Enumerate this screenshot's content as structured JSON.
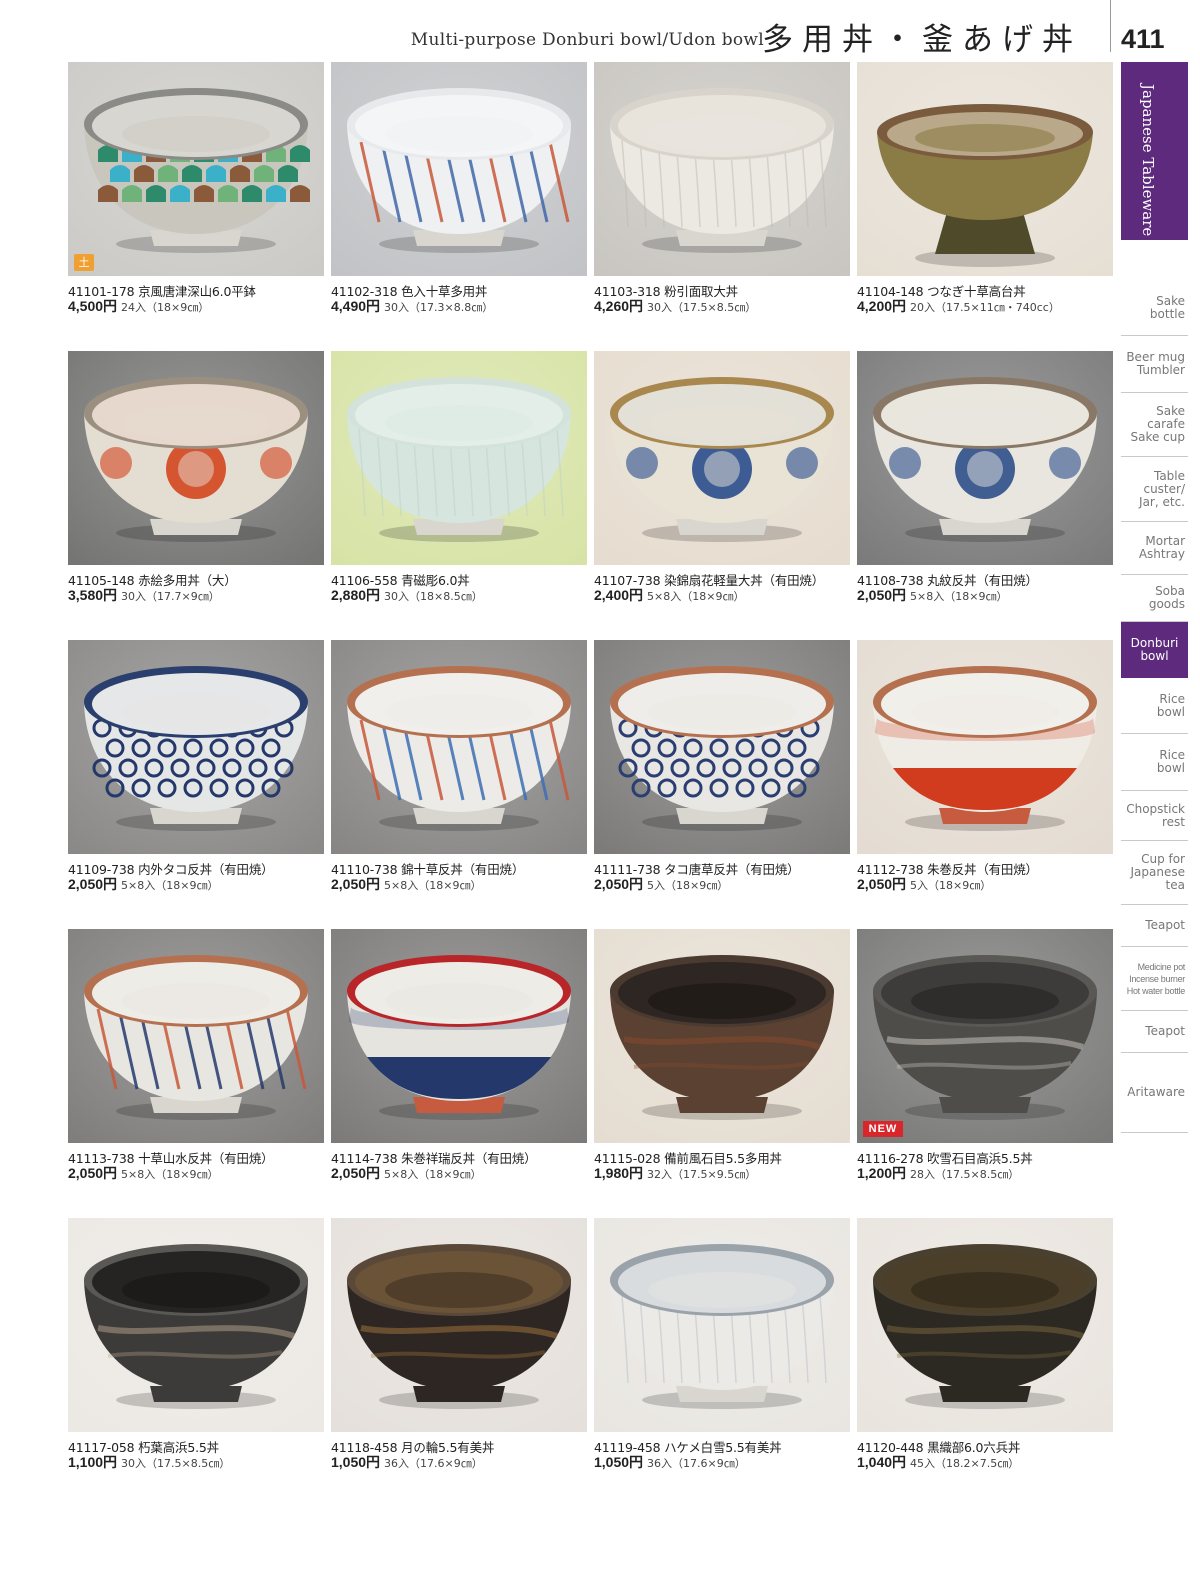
{
  "header": {
    "title_en": "Multi-purpose Donburi bowl/Udon bowl",
    "title_jp": "多用丼・釜あげ丼",
    "page_number": "411"
  },
  "sidebar": {
    "section_tab": "Japanese Tableware",
    "items": [
      {
        "label": "Sake\nbottle"
      },
      {
        "label": "Beer mug\nTumbler"
      },
      {
        "label": "Sake\ncarafe\nSake cup"
      },
      {
        "label": "Table\ncuster/\nJar, etc."
      },
      {
        "label": "Mortar\nAshtray"
      },
      {
        "label": "Soba\ngoods"
      },
      {
        "label": "Donburi\nbowl"
      },
      {
        "label": "Rice\nbowl"
      },
      {
        "label": "Rice\nbowl"
      },
      {
        "label": "Chopstick\nrest"
      },
      {
        "label": "Cup for\nJapanese\ntea"
      },
      {
        "label": "Teapot"
      },
      {
        "label": "Medicine pot\nIncense burner\nHot water bottle"
      },
      {
        "label": "Teapot"
      },
      {
        "label": "Aritaware"
      }
    ]
  },
  "products": [
    {
      "code": "41101-178",
      "name": "京風唐津深山6.0平鉢",
      "price": "4,500円",
      "spec": "24入（18×9㎝）",
      "badge": "土",
      "bg": "#cbcac6",
      "rim": "#8a8a86",
      "body": "#c9c6bd",
      "inner": "#d8d6d0",
      "accent": "#2d8a6a",
      "style": "pattern-scale"
    },
    {
      "code": "41102-318",
      "name": "色入十草多用丼",
      "price": "4,490円",
      "spec": "30入（17.3×8.8㎝）",
      "badge": "",
      "bg": "#c2c3c6",
      "rim": "#e8e9ec",
      "body": "#eef0f2",
      "inner": "#f4f5f6",
      "accent": "#3f67a8",
      "style": "stripes"
    },
    {
      "code": "41103-318",
      "name": "粉引面取大丼",
      "price": "4,260円",
      "spec": "30入（17.5×8.5㎝）",
      "badge": "",
      "bg": "#c9c6c1",
      "rim": "#d8d4cc",
      "body": "#ece9e3",
      "inner": "#e8e4dc",
      "accent": "#bfb9ae",
      "style": "plain"
    },
    {
      "code": "41104-148",
      "name": "つなぎ十草高台丼",
      "price": "4,200円",
      "spec": "20入（17.5×11㎝・740cc）",
      "badge": "",
      "bg": "#e6dfd4",
      "rim": "#7a5b3e",
      "body": "#8a7c44",
      "inner": "#b9a88a",
      "accent": "#4f4a2a",
      "style": "pedestal"
    },
    {
      "code": "41105-148",
      "name": "赤絵多用丼（大）",
      "price": "3,580円",
      "spec": "30入（17.7×9㎝）",
      "badge": "",
      "bg": "#757574",
      "rim": "#9b8f80",
      "body": "#e4ddd2",
      "inner": "#e6d8cd",
      "accent": "#d4461f",
      "style": "medallion"
    },
    {
      "code": "41106-558",
      "name": "青磁彫6.0丼",
      "price": "2,880円",
      "spec": "30入（18×8.5㎝）",
      "badge": "",
      "bg": "#d7e3a6",
      "rim": "#d3e2da",
      "body": "#d6e6df",
      "inner": "#e4eee9",
      "accent": "#bcd2c7",
      "style": "plain"
    },
    {
      "code": "41107-738",
      "name": "染錦扇花軽量大丼（有田焼）",
      "price": "2,400円",
      "spec": "5×8入（18×9㎝）",
      "badge": "",
      "bg": "#e6dccf",
      "rim": "#a8884f",
      "body": "#e9e3d6",
      "inner": "#e3e0d7",
      "accent": "#2b4d8d",
      "style": "medallion"
    },
    {
      "code": "41108-738",
      "name": "丸紋反丼（有田焼）",
      "price": "2,050円",
      "spec": "5×8入（18×9㎝）",
      "badge": "",
      "bg": "#7b7b7b",
      "rim": "#8a7866",
      "body": "#e8e6df",
      "inner": "#e9e6dd",
      "accent": "#2d4f8a",
      "style": "medallion"
    },
    {
      "code": "41109-738",
      "name": "内外タコ反丼（有田焼）",
      "price": "2,050円",
      "spec": "5×8入（18×9㎝）",
      "badge": "",
      "bg": "#8a8988",
      "rim": "#2b3f6f",
      "body": "#e5e6e6",
      "inner": "#e6e7e8",
      "accent": "#24386b",
      "style": "pattern-dots"
    },
    {
      "code": "41110-738",
      "name": "錦十草反丼（有田焼）",
      "price": "2,050円",
      "spec": "5×8入（18×9㎝）",
      "badge": "",
      "bg": "#878685",
      "rim": "#b5714f",
      "body": "#ecebe7",
      "inner": "#f0efeb",
      "accent": "#3d6fb3",
      "style": "stripes"
    },
    {
      "code": "41111-738",
      "name": "タコ唐草反丼（有田焼）",
      "price": "2,050円",
      "spec": "5入（18×9㎝）",
      "badge": "",
      "bg": "#7c7b7a",
      "rim": "#b5714f",
      "body": "#e8e7e3",
      "inner": "#eeede9",
      "accent": "#2a3e72",
      "style": "pattern-dots"
    },
    {
      "code": "41112-738",
      "name": "朱巻反丼（有田焼）",
      "price": "2,050円",
      "spec": "5入（18×9㎝）",
      "badge": "",
      "bg": "#e4dcd2",
      "rim": "#b5714f",
      "body": "#efece6",
      "inner": "#f1efea",
      "accent": "#d23c1e",
      "style": "band"
    },
    {
      "code": "41113-738",
      "name": "十草山水反丼（有田焼）",
      "price": "2,050円",
      "spec": "5×8入（18×9㎝）",
      "badge": "",
      "bg": "#7f7e7c",
      "rim": "#b5714f",
      "body": "#e8e6e1",
      "inner": "#eeece7",
      "accent": "#23386c",
      "style": "stripes"
    },
    {
      "code": "41114-738",
      "name": "朱巻祥瑞反丼（有田焼）",
      "price": "2,050円",
      "spec": "5×8入（18×9㎝）",
      "badge": "",
      "bg": "#7c7b7a",
      "rim": "#b8262a",
      "body": "#e6e4df",
      "inner": "#eeece7",
      "accent": "#24386b",
      "style": "band"
    },
    {
      "code": "41115-028",
      "name": "備前風石目5.5多用丼",
      "price": "1,980円",
      "spec": "32入（17.5×9.5㎝）",
      "badge": "",
      "bg": "#e5ddd1",
      "rim": "#4a3a30",
      "body": "#5b4132",
      "inner": "#2e2622",
      "accent": "#8a4a2a",
      "style": "dark"
    },
    {
      "code": "41116-278",
      "name": "吹雪石目高浜5.5丼",
      "price": "1,200円",
      "spec": "28入（17.5×8.5㎝）",
      "badge": "NEW",
      "bg": "#7a7a79",
      "rim": "#5a5855",
      "body": "#4f4d4a",
      "inner": "#3e3c3a",
      "accent": "#cfcac3",
      "style": "dark"
    },
    {
      "code": "41117-058",
      "name": "朽葉高浜5.5丼",
      "price": "1,100円",
      "spec": "30入（17.5×8.5㎝）",
      "badge": "",
      "bg": "#ece8e3",
      "rim": "#5a5855",
      "body": "#3d3b39",
      "inner": "#262423",
      "accent": "#b6a48c",
      "style": "dark"
    },
    {
      "code": "41118-458",
      "name": "月の輪5.5有美丼",
      "price": "1,050円",
      "spec": "36入（17.6×9㎝）",
      "badge": "",
      "bg": "#e5e0db",
      "rim": "#5a4838",
      "body": "#2e2622",
      "inner": "#6b5338",
      "accent": "#a4783d",
      "style": "dark"
    },
    {
      "code": "41119-458",
      "name": "ハケメ白雪5.5有美丼",
      "price": "1,050円",
      "spec": "36入（17.6×9㎝）",
      "badge": "",
      "bg": "#e9e6e1",
      "rim": "#9aa2aa",
      "body": "#eceae6",
      "inner": "#d9dcdf",
      "accent": "#b8c0c8",
      "style": "plain"
    },
    {
      "code": "41120-448",
      "name": "黒織部6.0六兵丼",
      "price": "1,040円",
      "spec": "45入（18.2×7.5㎝）",
      "badge": "",
      "bg": "#e9e4de",
      "rim": "#4a4030",
      "body": "#2c2822",
      "inner": "#4b3f2a",
      "accent": "#7c6a3e",
      "style": "dark"
    }
  ]
}
